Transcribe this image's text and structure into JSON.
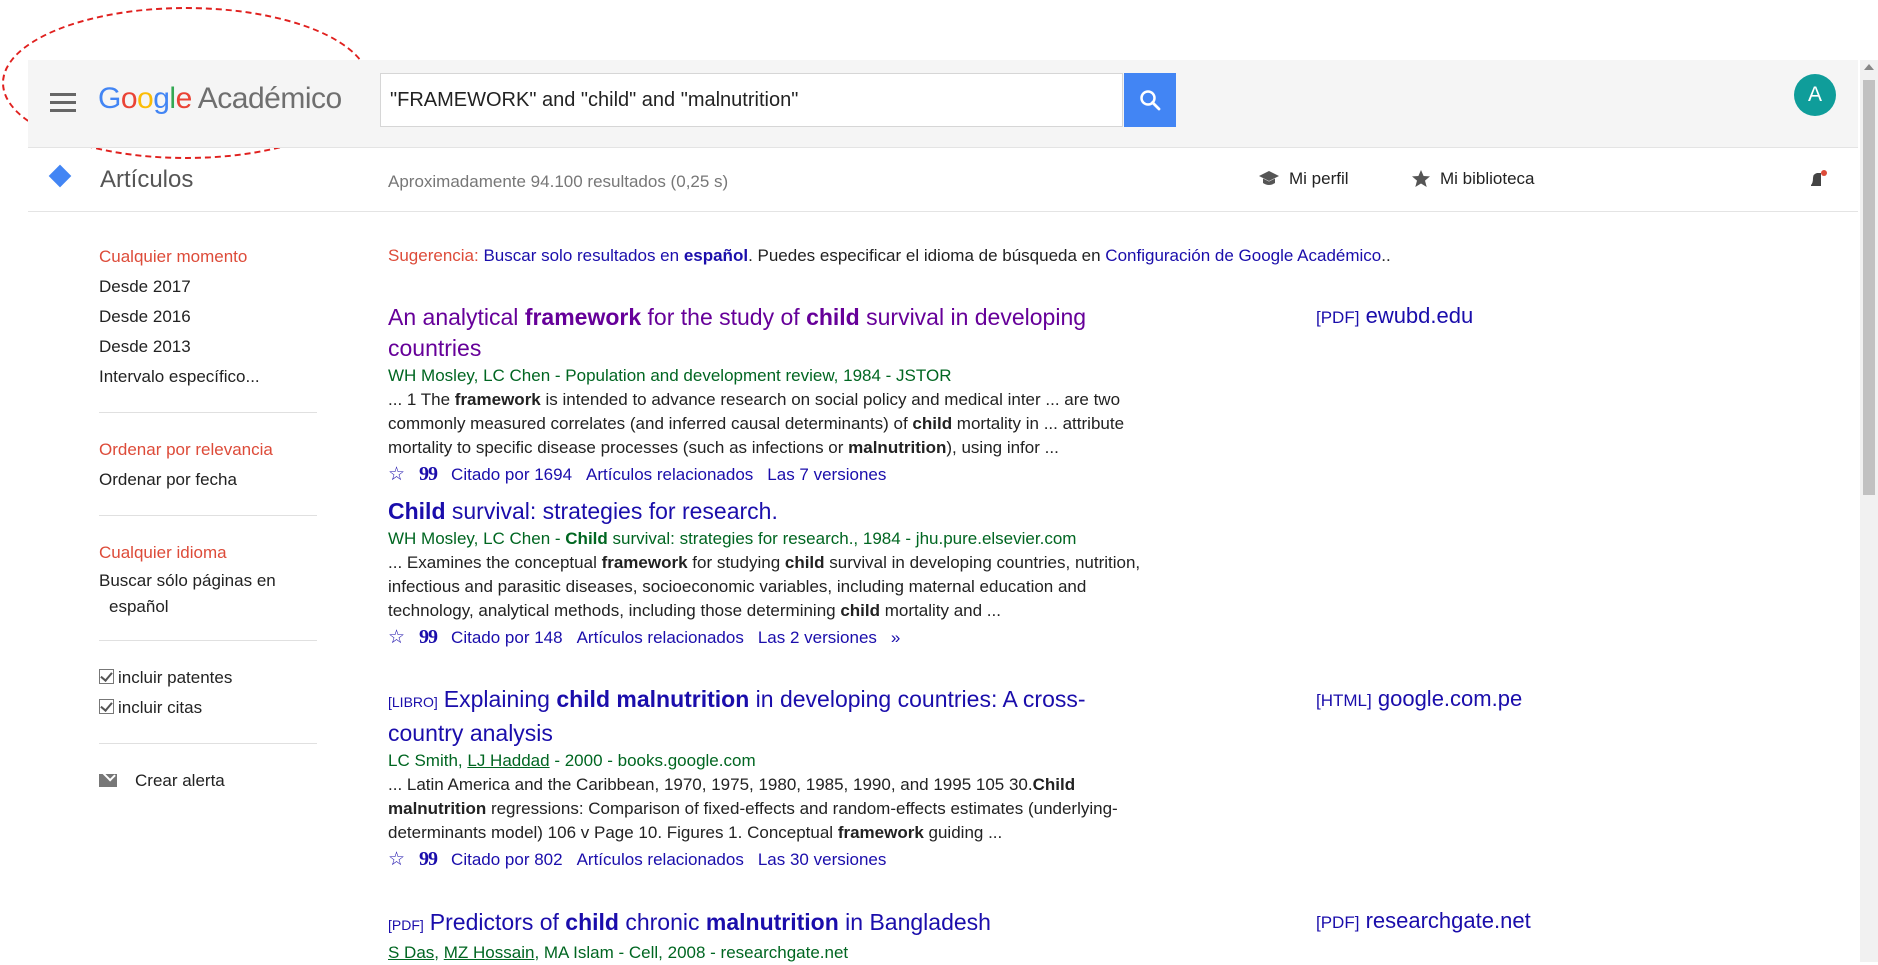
{
  "header": {
    "logo": {
      "g1": "G",
      "g2": "o",
      "g3": "o",
      "g4": "g",
      "g5": "l",
      "g6": "e",
      "product": "Académico"
    },
    "search_value": "\"FRAMEWORK\" and \"child\" and \"malnutrition\"",
    "avatar_letter": "A"
  },
  "subheader": {
    "section_label": "Artículos",
    "results_prefix": "Aproximadamente 94.100 resultados (",
    "results_time": "0,25",
    "results_suffix": " s)",
    "profile_label": "Mi perfil",
    "library_label": "Mi biblioteca"
  },
  "sidebar": {
    "time": [
      "Cualquier momento",
      "Desde 2017",
      "Desde 2016",
      "Desde 2013",
      "Intervalo específico..."
    ],
    "sort": [
      "Ordenar por relevancia",
      "Ordenar por fecha"
    ],
    "language": [
      "Cualquier idioma",
      "Buscar sólo páginas en",
      "español"
    ],
    "include_patents": "incluir patentes",
    "include_citations": "incluir citas",
    "create_alert": "Crear alerta"
  },
  "suggestion": {
    "label": "Sugerencia:",
    "link_pre": "Buscar solo resultados en ",
    "link_bold": "español",
    "middle": ". Puedes especificar el idioma de búsqueda en ",
    "settings_link": "Configuración de Google Académico",
    "end": ".."
  },
  "results": [
    {
      "title": [
        "An analytical ",
        "framework",
        " for the study of ",
        "child",
        " survival in developing countries"
      ],
      "authors": "WH Mosley, LC Chen - Population and development review, 1984 - JSTOR",
      "snippet": [
        "... 1 The ",
        "framework",
        " is intended to advance research on social policy and medical inter ... are two commonly measured correlates (and inferred causal determinants) of ",
        "child",
        " mortality in ... attribute mortality to specific disease processes (such as infections or ",
        "malnutrition",
        "), using infor ..."
      ],
      "cited_by": "Citado por 1694",
      "related": "Artículos relacionados",
      "versions": "Las 7 versiones",
      "side_format": "[PDF]",
      "side_source": "ewubd.edu"
    },
    {
      "title": [
        "Child",
        " survival: strategies for research."
      ],
      "authors_parts": [
        "WH Mosley, LC Chen - ",
        "Child",
        " survival: strategies for research., 1984 - jhu.pure.elsevier.com"
      ],
      "snippet": [
        "... Examines the conceptual ",
        "framework",
        " for studying ",
        "child",
        " survival in developing countries, nutrition, infectious and parasitic diseases, socioeconomic variables, including maternal education and technology, analytical methods, including those determining ",
        "child",
        " mortality and ..."
      ],
      "cited_by": "Citado por 148",
      "related": "Artículos relacionados",
      "versions": "Las 2 versiones",
      "more": "»"
    },
    {
      "tag": "[LIBRO]",
      "title": [
        "Explaining ",
        "child malnutrition",
        " in developing countries: A cross-country analysis"
      ],
      "authors_parts": [
        "LC Smith, ",
        "LJ Haddad",
        " - 2000 - books.google.com"
      ],
      "snippet": [
        "... Latin America and the Caribbean, 1970, 1975, 1980, 1985, 1990, and 1995 105 30.",
        "Child malnutrition",
        " regressions: Comparison of fixed-effects and random-effects estimates (underlying-determinants model) 106 v Page 10. Figures 1. Conceptual ",
        "framework",
        " guiding ..."
      ],
      "cited_by": "Citado por 802",
      "related": "Artículos relacionados",
      "versions": "Las 30 versiones",
      "side_format": "[HTML]",
      "side_source": "google.com.pe"
    },
    {
      "tag": "[PDF]",
      "title": [
        "Predictors of ",
        "child",
        " chronic ",
        "malnutrition",
        " in Bangladesh"
      ],
      "authors_parts": [
        "S Das",
        ", ",
        "MZ Hossain",
        ", MA Islam - Cell, 2008 - researchgate.net"
      ],
      "side_format": "[PDF]",
      "side_source": "researchgate.net"
    }
  ],
  "icons": {
    "star": "☆",
    "quote": "99"
  }
}
